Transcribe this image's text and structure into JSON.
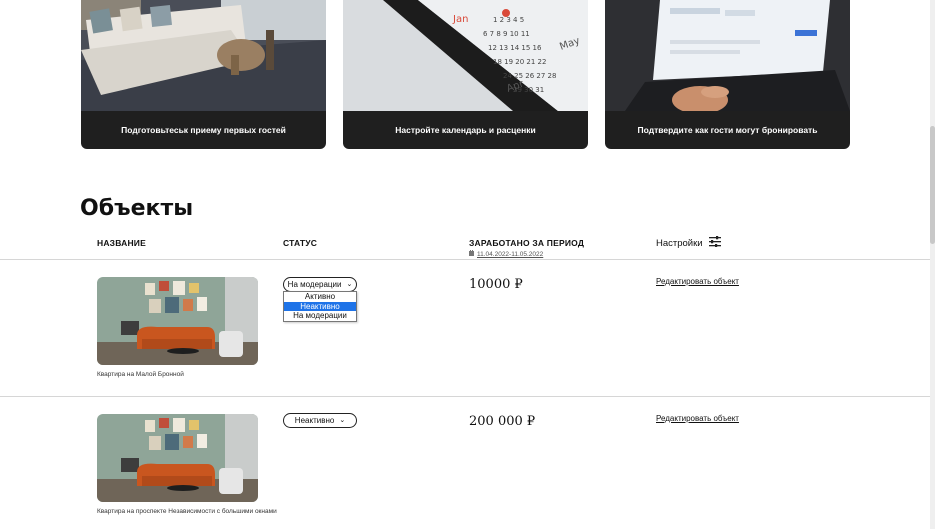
{
  "cards": [
    {
      "caption": "Подготовьтеськ приему первых гостей"
    },
    {
      "caption": "Настройте календарь и расценки"
    },
    {
      "caption": "Подтвердите как гости могут бронировать"
    }
  ],
  "calendar_words": {
    "jan": "Jan",
    "may": "May",
    "apr": "Apr"
  },
  "section_title": "Объекты",
  "columns": {
    "name": "НАЗВАНИЕ",
    "status": "СТАТУС",
    "earned": "ЗАРАБОТАНО ЗА ПЕРИОД",
    "period": "11.04.2022-11.05.2022",
    "settings": "Настройки"
  },
  "objects": [
    {
      "name": "Квартира на Малой Бронной",
      "status": "На модерации",
      "earned": "10000 ₽",
      "edit": "Редактировать объект"
    },
    {
      "name": "Квартира на проспекте Независимости с большими окнами",
      "status": "Неактивно",
      "earned": "200 000 ₽",
      "edit": "Редактировать объект"
    }
  ],
  "status_options": [
    "Активно",
    "Неактивно",
    "На модерации"
  ],
  "status_selected_option": "Неактивно",
  "colors": {
    "dark_card": "#1f1f1f",
    "selection": "#1e73e8"
  }
}
